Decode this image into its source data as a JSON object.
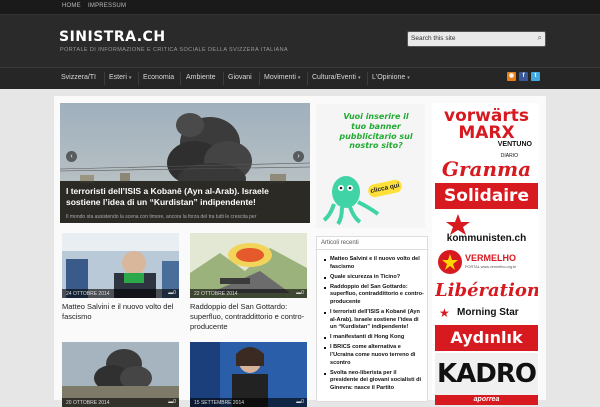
{
  "topbar": {
    "links": [
      "HOME",
      "IMPRESSUM"
    ]
  },
  "site": {
    "name": "SINISTRA.CH",
    "tagline": "PORTALE DI INFORMAZIONE E CRITICA SOCIALE DELLA SVIZZERA ITALIANA"
  },
  "search": {
    "value": "Search this site",
    "icon": "search-icon"
  },
  "nav": {
    "items": [
      {
        "label": "Svizzera/TI",
        "dropdown": false
      },
      {
        "label": "Esteri",
        "dropdown": true
      },
      {
        "label": "Economia",
        "dropdown": false
      },
      {
        "label": "Ambiente",
        "dropdown": false
      },
      {
        "label": "Giovani",
        "dropdown": false
      },
      {
        "label": "Movimenti",
        "dropdown": true
      },
      {
        "label": "Cultura/Eventi",
        "dropdown": true
      },
      {
        "label": "L'Opinione",
        "dropdown": true
      }
    ],
    "caret": "▾",
    "social": [
      {
        "icon": "rss-icon",
        "color": "#e8801a"
      },
      {
        "icon": "facebook-icon",
        "color": "#3b5998"
      },
      {
        "icon": "twitter-icon",
        "color": "#3fa9e0"
      }
    ]
  },
  "slider": {
    "title": "I terroristi dell’ISIS a Kobanê (Ayn al-Arab). Israele sostiene l’idea di un “Kurdistan” indipendente!",
    "excerpt": "Il mondo sta assistendo la scena con timore, ancora la forza del tra tutti le crescita per",
    "prev_icon": "‹",
    "next_icon": "›"
  },
  "posts": [
    {
      "date": "24 OTTOBRE 2014",
      "comments": "0",
      "title": "Matteo Salvini e il nuovo volto del fascismo"
    },
    {
      "date": "22 OTTOBRE 2014",
      "comments": "0",
      "title": "Raddoppio del San Gottardo: superfluo, contraddittorio e contro-producente"
    },
    {
      "date": "20 OTTOBRE 2014",
      "comments": "0",
      "title": ""
    },
    {
      "date": "15 SETTEMBRE 2014",
      "comments": "0",
      "title": ""
    }
  ],
  "ad": {
    "text": "Vuoi inserire il tuo banner pubblicitario sul nostro sito?",
    "cta": "clicca qui"
  },
  "recent": {
    "title": "Articoli recenti",
    "items": [
      "Matteo Salvini e il nuovo volto del fascismo",
      "Quale sicurezza in Ticino?",
      "Raddoppio del San Gottardo: superfluo, contraddittorio e contro-producente",
      "I terroristi dell’ISIS a Kobanê (Ayn al-Arab). Israele sostiene l’idea di un “Kurdistan” indipendente!",
      "I manifestanti di Hong Kong",
      "I BRICS come alternativa e l’Ucraina come nuovo terreno di scontro",
      "Svolta neo-liberista per il presidente dei giovani socialisti di Ginevra: nasce il Partito"
    ]
  },
  "banners": {
    "vorwarts": "vorwärts",
    "marx": "MARX",
    "ventuno": "VENTUNO",
    "diario": "DIARIO",
    "granma": "Granma",
    "solidaire": "Solidaire",
    "kommunisten": "kommunisten.ch",
    "vermelho": "VERMELHO",
    "vermelho_sub": "PORTAL www.vermelho.org.br",
    "liberation": "Libération",
    "morningstar": "Morning Star",
    "aydinlik": "Aydınlık",
    "kadro": "KADRO",
    "aporrea": "aporrea"
  },
  "colors": {
    "accent_red": "#d71920",
    "ad_green": "#22aa33",
    "nav_bg": "#262626"
  }
}
